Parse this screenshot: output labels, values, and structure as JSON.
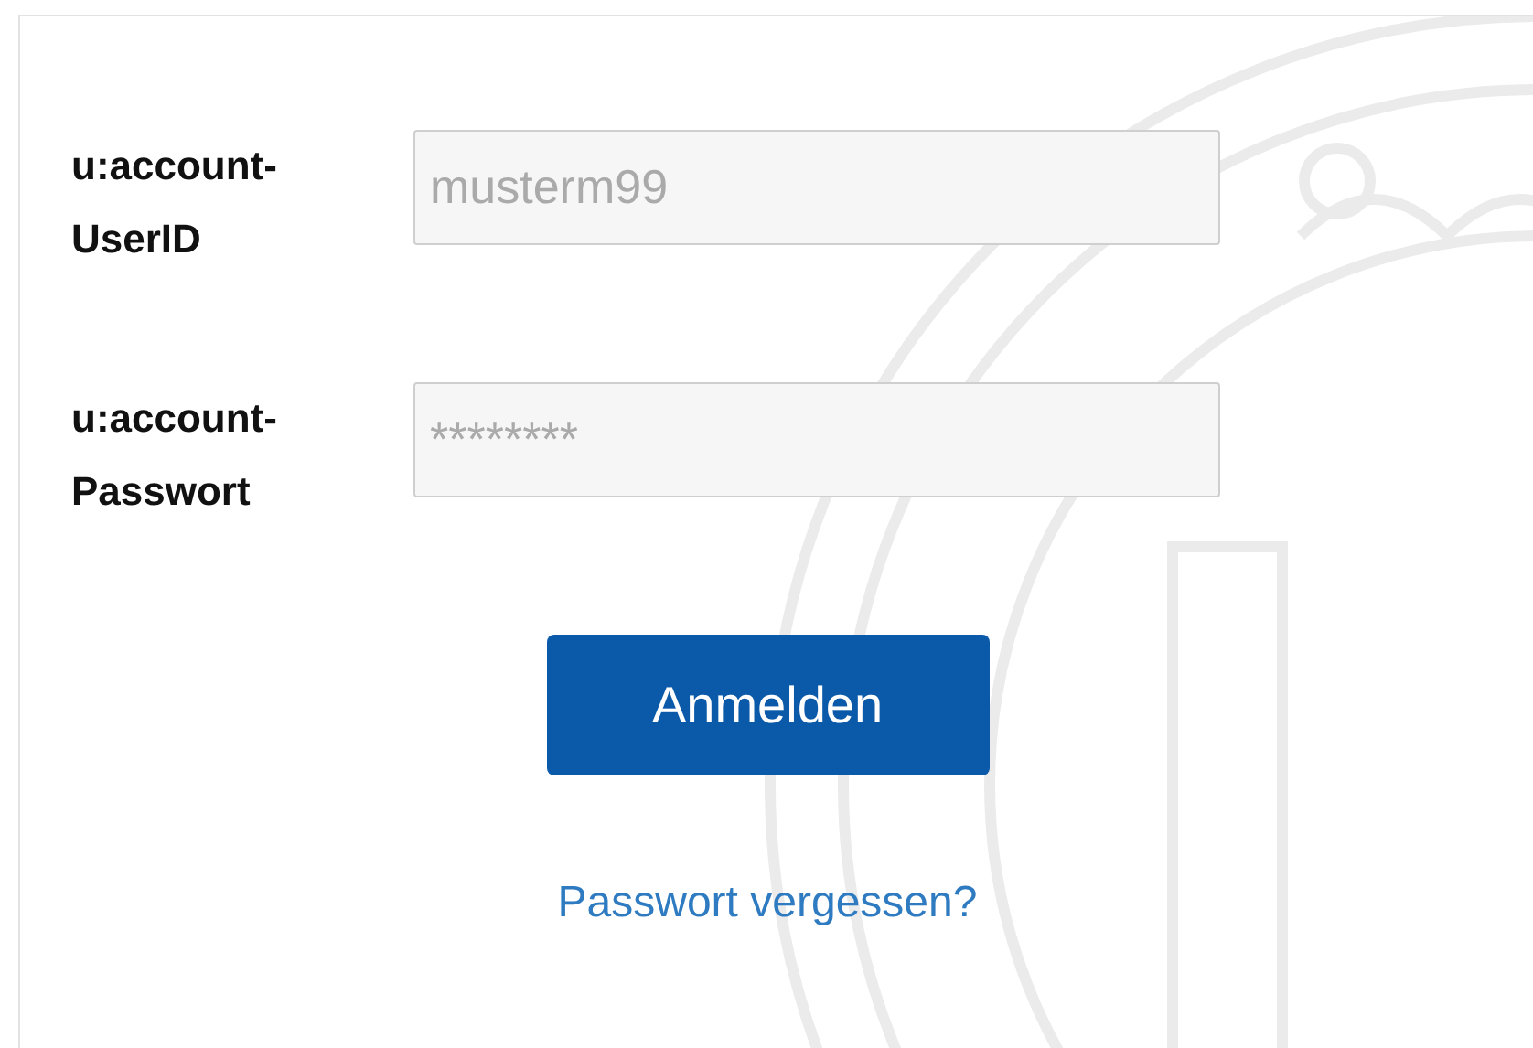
{
  "login_form": {
    "fields": [
      {
        "label": "u:account-UserID",
        "placeholder": "musterm99"
      },
      {
        "label": "u:account-Passwort",
        "placeholder": "********"
      }
    ],
    "submit_button": "Anmelden",
    "forgot_link": "Passwort vergessen?"
  }
}
